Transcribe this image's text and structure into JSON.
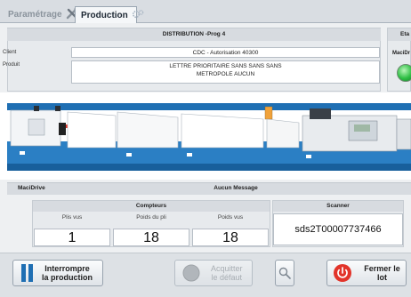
{
  "tabs": [
    {
      "label": "Paramétrage",
      "icon": "tools-icon",
      "active": false
    },
    {
      "label": "Production",
      "icon": "gears-icon",
      "active": true
    }
  ],
  "section": {
    "title": "DISTRIBUTION -Prog 4",
    "client_label": "Client",
    "client_value": "CDC - Autorisation 40300",
    "produit_label": "Produit",
    "produit_line1": "LETTRE PRIORITAIRE SANS SANS SANS",
    "produit_line2": "METROPOLE AUCUN"
  },
  "status": {
    "title": "Eta",
    "label": "MaciDr",
    "led_color": "#2fbf45"
  },
  "message_bar": {
    "label": "MaciDrive",
    "message": "Aucun Message"
  },
  "counters": {
    "title": "Compteurs",
    "columns": [
      {
        "label": "Plis vus",
        "value": "1"
      },
      {
        "label": "Poids du pli",
        "value": "18"
      },
      {
        "label": "Poids vus",
        "value": "18"
      }
    ]
  },
  "scanner": {
    "title": "Scanner",
    "value": "sds2T00007737466"
  },
  "buttons": {
    "stop_line1": "Interrompre",
    "stop_line2": "la production",
    "ack_line1": "Acquitter",
    "ack_line2": "le défaut",
    "close_label": "Fermer le lot"
  },
  "colors": {
    "accent_blue": "#1f6fb3",
    "close_red": "#e2342a"
  }
}
